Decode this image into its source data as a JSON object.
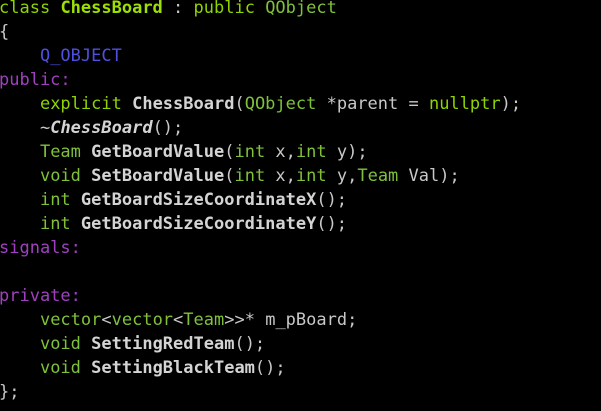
{
  "editor": {
    "background": "#000000",
    "colors": {
      "keyword": "#8fd400",
      "class_name": "#9ee000",
      "function_name": "#d4d4d4",
      "macro": "#4f4fe0",
      "access_specifier": "#a040c0",
      "plain": "#c8c8c8"
    },
    "lines": {
      "l1": {
        "kw_class": "class",
        "name": "ChessBoard",
        "colon": " : ",
        "kw_public": "public",
        "base": "QObject"
      },
      "l2": {
        "brace": "{"
      },
      "l3": {
        "macro": "Q_OBJECT"
      },
      "l4": {
        "access": "public:"
      },
      "l5": {
        "kw": "explicit",
        "fn": "ChessBoard",
        "open": "(",
        "type": "QObject",
        "param": " *parent = ",
        "lit": "nullptr",
        "close": ");"
      },
      "l6": {
        "tilde": "~",
        "fn": "ChessBoard",
        "rest": "();"
      },
      "l7": {
        "type": "Team",
        "fn": "GetBoardValue",
        "open": "(",
        "t1": "int",
        "p1": " x,",
        "t2": "int",
        "p2": " y",
        "close": ");"
      },
      "l8": {
        "type": "void",
        "fn": "SetBoardValue",
        "open": "(",
        "t1": "int",
        "p1": " x,",
        "t2": "int",
        "p2": " y,",
        "t3": "Team",
        "p3": " Val",
        "close": ");"
      },
      "l9": {
        "type": "int",
        "fn": "GetBoardSizeCoordinateX",
        "rest": "();"
      },
      "l10": {
        "type": "int",
        "fn": "GetBoardSizeCoordinateY",
        "rest": "();"
      },
      "l11": {
        "access": "signals:"
      },
      "l12": {},
      "l13": {
        "access": "private:"
      },
      "l14": {
        "t1": "vector",
        "lt1": "<",
        "t2": "vector",
        "lt2": "<",
        "t3": "Team",
        "gt": ">>* ",
        "var": "m_pBoard;"
      },
      "l15": {
        "type": "void",
        "fn": "SettingRedTeam",
        "rest": "();"
      },
      "l16": {
        "type": "void",
        "fn": "SettingBlackTeam",
        "rest": "();"
      },
      "l17": {
        "brace": "};"
      }
    }
  }
}
